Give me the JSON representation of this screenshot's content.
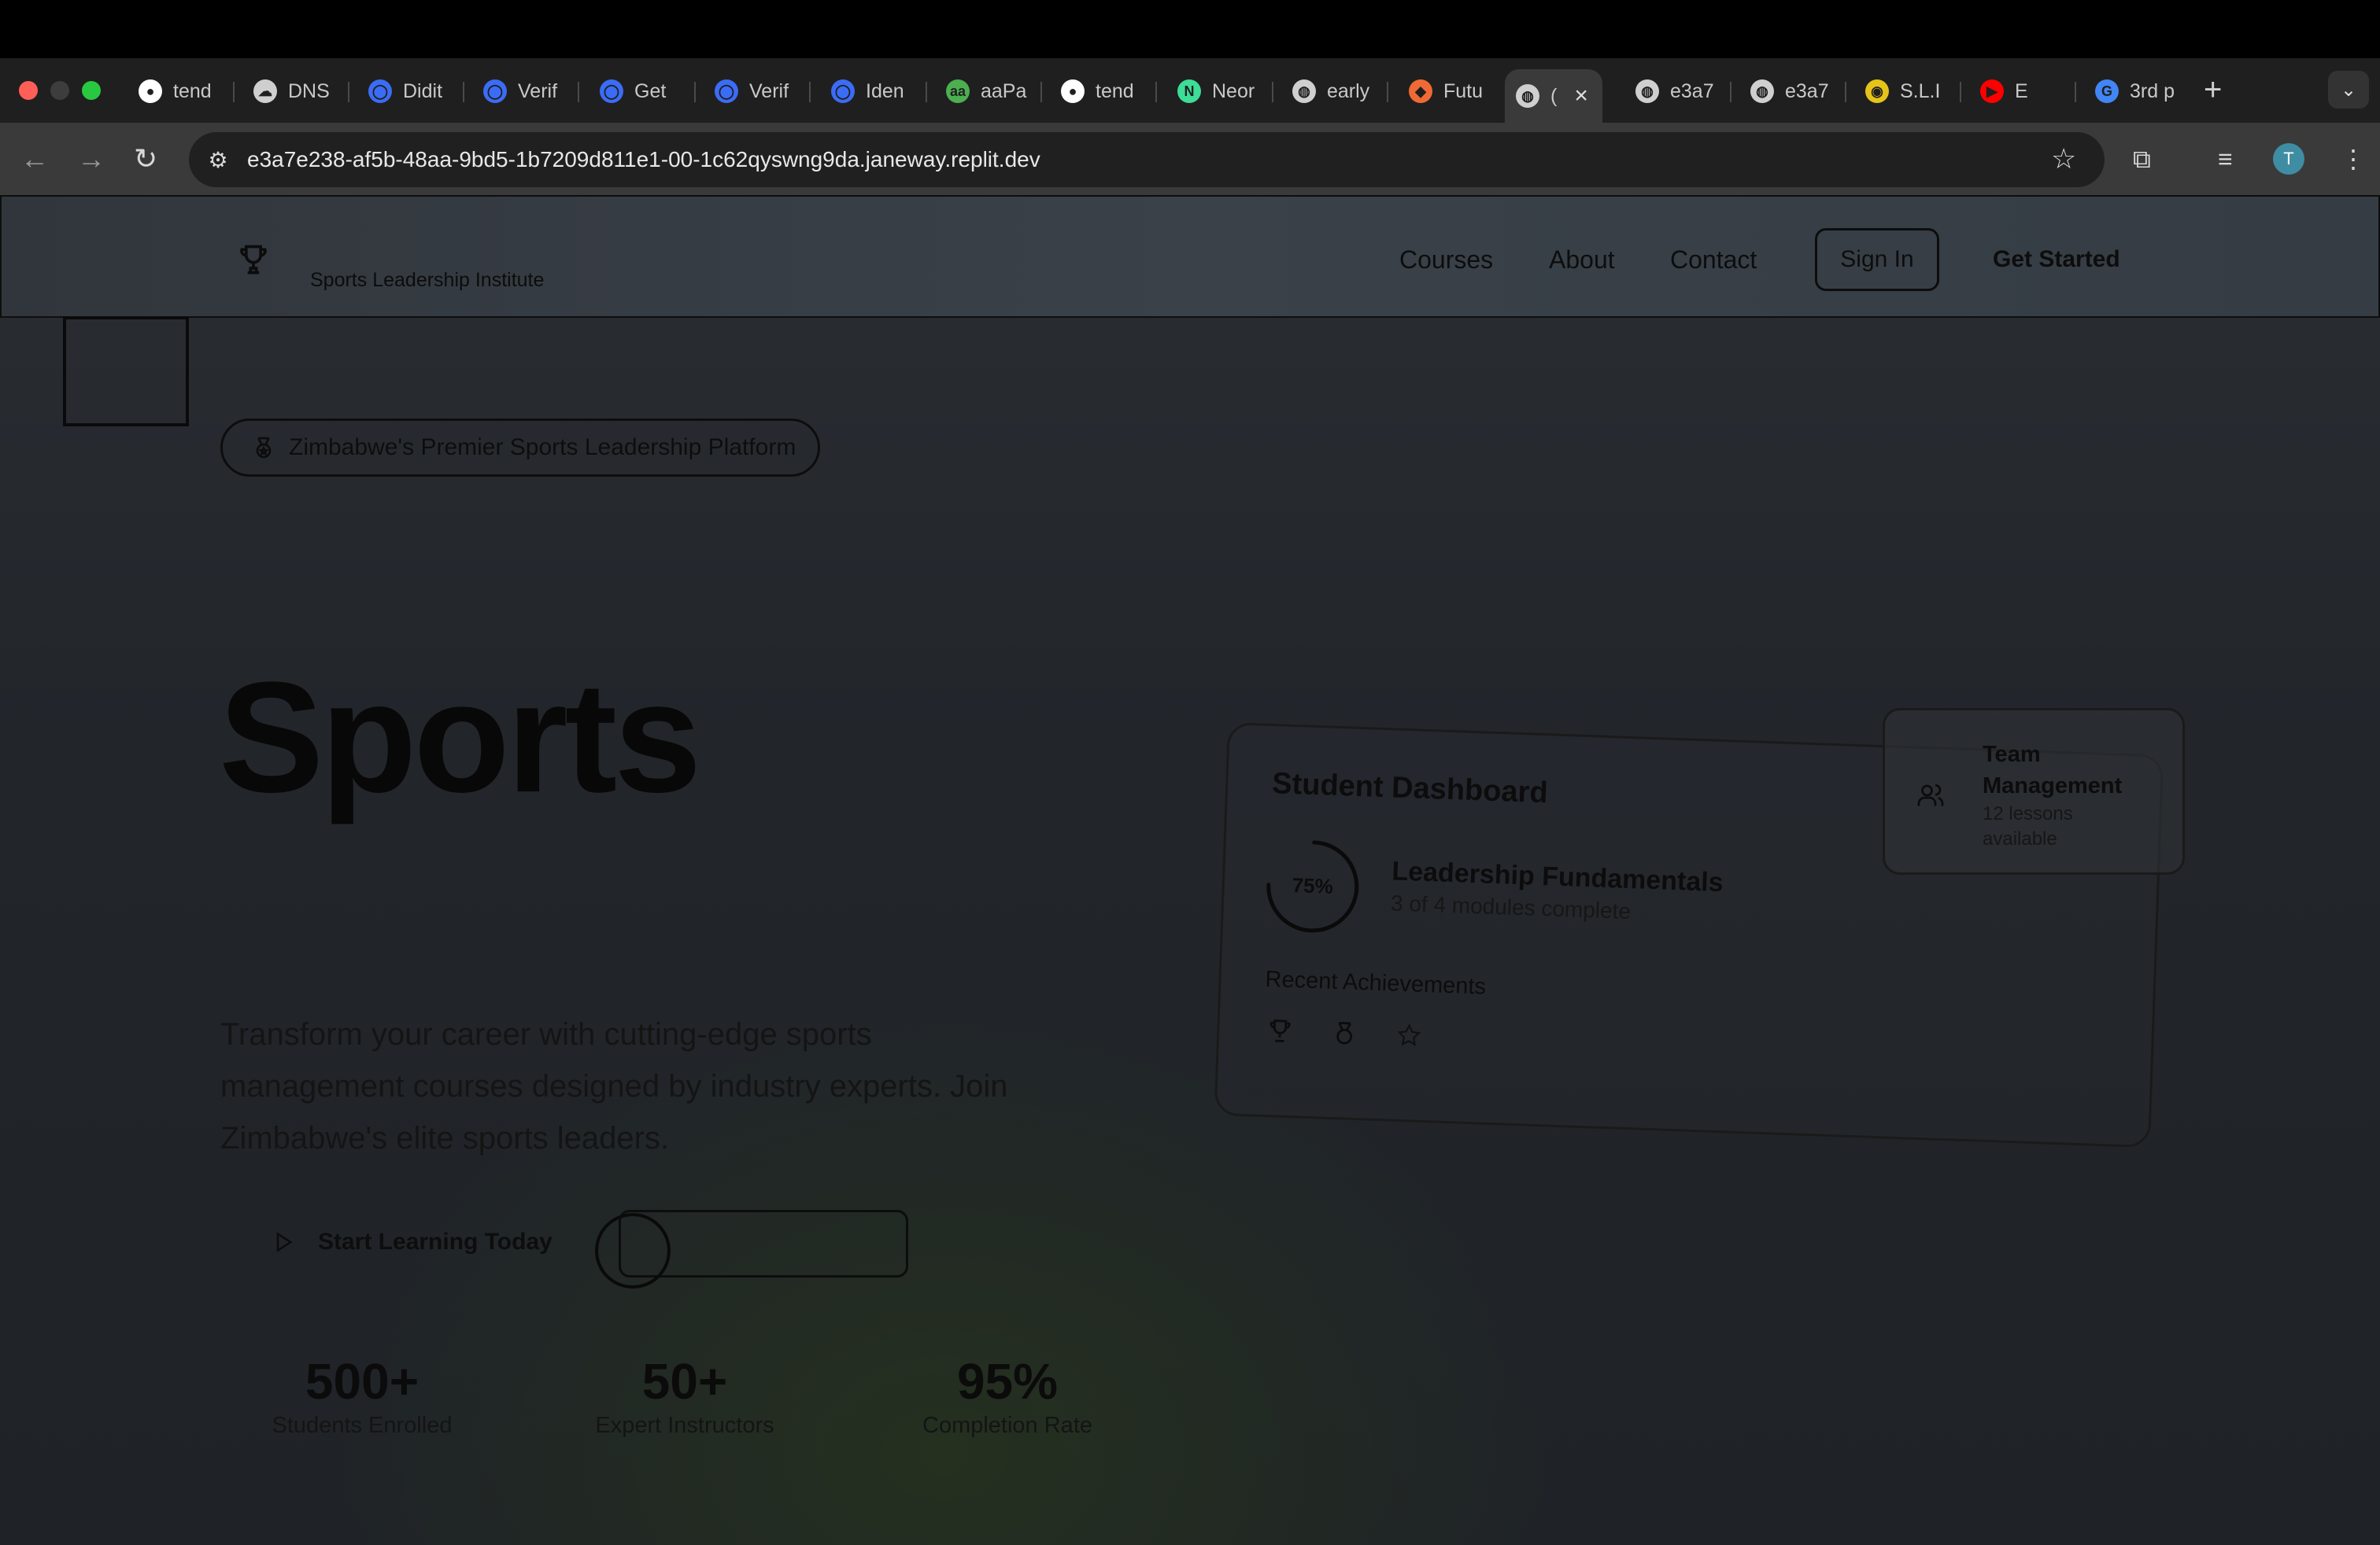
{
  "browser": {
    "tabs": [
      {
        "label": "tend",
        "icon": "github-icon",
        "color": "#ffffff"
      },
      {
        "label": "DNS",
        "icon": "cloud-icon",
        "color": "#cfcfcf"
      },
      {
        "label": "Didit",
        "icon": "didit-icon",
        "color": "#3b6cf6"
      },
      {
        "label": "Verif",
        "icon": "didit-icon",
        "color": "#3b6cf6"
      },
      {
        "label": "Get",
        "icon": "didit-icon",
        "color": "#3b6cf6"
      },
      {
        "label": "Verif",
        "icon": "didit-icon",
        "color": "#3b6cf6"
      },
      {
        "label": "Iden",
        "icon": "ring-icon",
        "color": "#3b6cf6"
      },
      {
        "label": "aaPa",
        "icon": "aa-icon",
        "color": "#4caf50"
      },
      {
        "label": "tend",
        "icon": "github-icon",
        "color": "#ffffff"
      },
      {
        "label": "Neor",
        "icon": "neon-icon",
        "color": "#3ddc97"
      },
      {
        "label": "early",
        "icon": "globe-icon",
        "color": "#cfcfcf"
      },
      {
        "label": "Futu",
        "icon": "figma-icon",
        "color": "#f06a35"
      },
      {
        "label": "(",
        "icon": "globe-icon",
        "color": "#cfcfcf"
      },
      {
        "label": "e3a7",
        "icon": "globe-icon",
        "color": "#cfcfcf"
      },
      {
        "label": "e3a7",
        "icon": "globe-icon",
        "color": "#cfcfcf"
      },
      {
        "label": "S.L.I",
        "icon": "sli-icon",
        "color": "#e6c319"
      },
      {
        "label": "E",
        "icon": "youtube-icon",
        "color": "#ff0000"
      },
      {
        "label": "3rd p",
        "icon": "google-icon",
        "color": "#4285f4"
      }
    ],
    "url": "e3a7e238-af5b-48aa-9bd5-1b7209d811e1-00-1c62qyswng9da.janeway.replit.dev",
    "profile_initial": "T",
    "newtab_glyph": "+",
    "tabmenu_glyph": "⌄"
  },
  "site": {
    "brand": "Sports Leadership Institute",
    "nav": {
      "courses": "Courses",
      "about": "About",
      "contact": "Contact"
    },
    "signin": "Sign In",
    "get_started": "Get Started"
  },
  "hero": {
    "badge": "Zimbabwe's Premier Sports Leadership Platform",
    "title": "Sports",
    "subtitle": "Transform your career with cutting-edge sports management courses designed by industry experts. Join Zimbabwe's elite sports leaders.",
    "cta_primary": "Start Learning Today"
  },
  "stats": [
    {
      "value": "500+",
      "label": "Students Enrolled"
    },
    {
      "value": "50+",
      "label": "Expert Instructors"
    },
    {
      "value": "95%",
      "label": "Completion Rate"
    }
  ],
  "dashboard": {
    "title": "Student Dashboard",
    "progress": 0.75,
    "progress_label": "75%",
    "course": "Leadership Fundamentals",
    "course_progress": "3 of 4 modules complete",
    "achievements_title": "Recent Achievements",
    "achievement_icons": [
      "trophy-icon",
      "medal-icon",
      "star-icon"
    ]
  },
  "team_card": {
    "title": "Team Management",
    "subtitle": "12 lessons available"
  }
}
